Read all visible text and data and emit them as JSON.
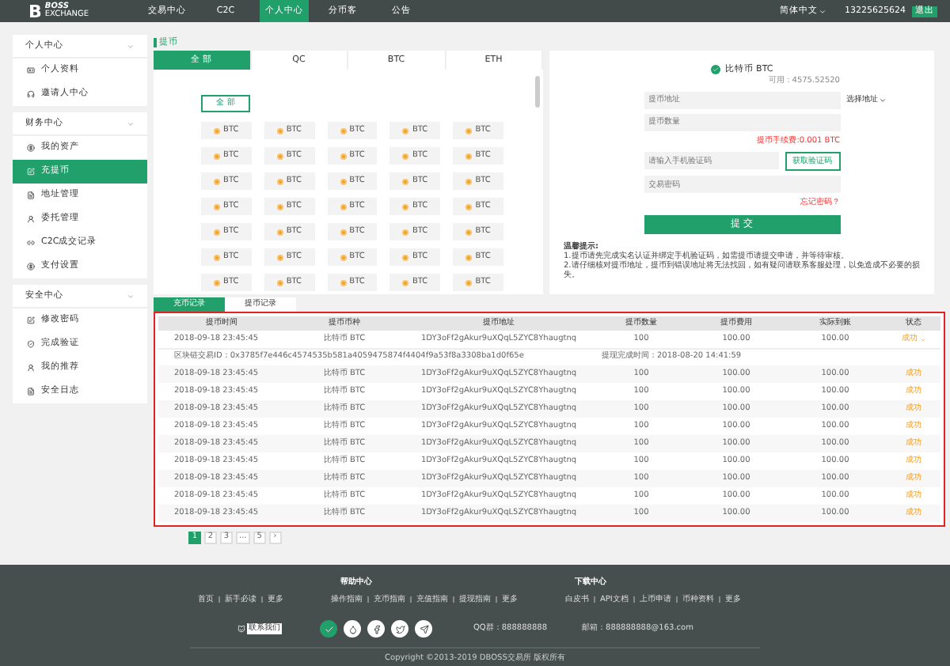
{
  "nav": {
    "logo_letter": "B",
    "logo_text": "BOSS",
    "logo_sub": "EXCHANGE",
    "items": [
      {
        "label": "交易中心",
        "selected": false
      },
      {
        "label": "C2C",
        "selected": false
      },
      {
        "label": "个人中心",
        "selected": true
      },
      {
        "label": "分币客",
        "selected": false
      },
      {
        "label": "公告",
        "selected": false
      }
    ],
    "language": "简体中文",
    "phone": "13225625624",
    "logout": "退出"
  },
  "sidebar": {
    "sections": [
      {
        "title": "个人中心",
        "expanded": true,
        "items": [
          {
            "label": "个人资料",
            "selected": false
          },
          {
            "label": "邀请人中心",
            "selected": false
          }
        ]
      },
      {
        "title": "财务中心",
        "expanded": true,
        "items": [
          {
            "label": "我的资产",
            "selected": false
          },
          {
            "label": "充提币",
            "selected": true
          },
          {
            "label": "地址管理",
            "selected": false
          },
          {
            "label": "委托管理",
            "selected": false
          },
          {
            "label": "C2C成交记录",
            "selected": false
          },
          {
            "label": "支付设置",
            "selected": false
          }
        ]
      },
      {
        "title": "安全中心",
        "expanded": true,
        "items": [
          {
            "label": "修改密码",
            "selected": false
          },
          {
            "label": "完成验证",
            "selected": false
          },
          {
            "label": "我的推荐",
            "selected": false
          },
          {
            "label": "安全日志",
            "selected": false
          }
        ]
      }
    ]
  },
  "withdraw": {
    "section_title": "提币",
    "coin_tabs": [
      {
        "label": "全 部",
        "selected": true
      },
      {
        "label": "QC",
        "selected": false
      },
      {
        "label": "BTC",
        "selected": false
      },
      {
        "label": "ETH",
        "selected": false
      }
    ],
    "all_button": "全 部",
    "coins": [
      {
        "symbol": "BTC"
      },
      {
        "symbol": "BTC"
      },
      {
        "symbol": "BTC"
      },
      {
        "symbol": "BTC"
      },
      {
        "symbol": "BTC"
      },
      {
        "symbol": "BTC"
      },
      {
        "symbol": "BTC"
      },
      {
        "symbol": "BTC"
      },
      {
        "symbol": "BTC"
      },
      {
        "symbol": "BTC"
      },
      {
        "symbol": "BTC"
      },
      {
        "symbol": "BTC"
      },
      {
        "symbol": "BTC"
      },
      {
        "symbol": "BTC"
      },
      {
        "symbol": "BTC"
      },
      {
        "symbol": "BTC"
      },
      {
        "symbol": "BTC"
      },
      {
        "symbol": "BTC"
      },
      {
        "symbol": "BTC"
      },
      {
        "symbol": "BTC"
      },
      {
        "symbol": "BTC"
      },
      {
        "symbol": "BTC"
      },
      {
        "symbol": "BTC"
      },
      {
        "symbol": "BTC"
      },
      {
        "symbol": "BTC"
      },
      {
        "symbol": "BTC"
      },
      {
        "symbol": "BTC"
      },
      {
        "symbol": "BTC"
      },
      {
        "symbol": "BTC"
      },
      {
        "symbol": "BTC"
      },
      {
        "symbol": "BTC"
      },
      {
        "symbol": "BTC"
      },
      {
        "symbol": "BTC"
      },
      {
        "symbol": "BTC"
      },
      {
        "symbol": "BTC"
      }
    ]
  },
  "form": {
    "coin_name": "比特币 BTC",
    "available": "可用：4575.52520",
    "address_placeholder": "提币地址",
    "select_address": "选择地址",
    "amount_placeholder": "提币数量",
    "fee_note": "提币手续费:0.001 BTC",
    "code_placeholder": "请输入手机验证码",
    "get_code": "获取验证码",
    "password_placeholder": "交易密码",
    "forgot": "忘记密码？",
    "submit": "提 交",
    "tips_title": "温馨提示:",
    "tips": [
      "1.提币请先完成实名认证并绑定手机验证码，如需提币请提交申请，并等待审核。",
      "2.请仔细核对提币地址，提币到错误地址将无法找回，如有疑问请联系客服处理，以免造成不必要的损失。"
    ]
  },
  "records": {
    "tabs": [
      {
        "label": "充币记录",
        "selected": true
      },
      {
        "label": "提币记录",
        "selected": false
      }
    ],
    "columns": [
      "提币时间",
      "提币币种",
      "提币地址",
      "提币数量",
      "提币费用",
      "实际到账",
      "状态"
    ],
    "rows": [
      {
        "cells": [
          "2018-09-18 23:45:45",
          "比特币 BTC",
          "1DY3oFf2gAkur9uXQqL5ZYC8Yhaugtnq",
          "100",
          "100.00",
          "100.00"
        ],
        "status": "成功",
        "expanded": true,
        "txid": "区块链交易ID：0x3785f7e446c4574535b581a4059475874f4404f9a53f8a3308ba1d0f65e",
        "finish_time": "提现完成时间：2018-08-20 14:41:59"
      },
      {
        "cells": [
          "2018-09-18 23:45:45",
          "比特币 BTC",
          "1DY3oFf2gAkur9uXQqL5ZYC8Yhaugtnq",
          "100",
          "100.00",
          "100.00"
        ],
        "status": "成功",
        "expanded": false
      },
      {
        "cells": [
          "2018-09-18 23:45:45",
          "比特币 BTC",
          "1DY3oFf2gAkur9uXQqL5ZYC8Yhaugtnq",
          "100",
          "100.00",
          "100.00"
        ],
        "status": "成功",
        "expanded": false
      },
      {
        "cells": [
          "2018-09-18 23:45:45",
          "比特币 BTC",
          "1DY3oFf2gAkur9uXQqL5ZYC8Yhaugtnq",
          "100",
          "100.00",
          "100.00"
        ],
        "status": "成功",
        "expanded": false
      },
      {
        "cells": [
          "2018-09-18 23:45:45",
          "比特币 BTC",
          "1DY3oFf2gAkur9uXQqL5ZYC8Yhaugtnq",
          "100",
          "100.00",
          "100.00"
        ],
        "status": "成功",
        "expanded": false
      },
      {
        "cells": [
          "2018-09-18 23:45:45",
          "比特币 BTC",
          "1DY3oFf2gAkur9uXQqL5ZYC8Yhaugtnq",
          "100",
          "100.00",
          "100.00"
        ],
        "status": "成功",
        "expanded": false
      },
      {
        "cells": [
          "2018-09-18 23:45:45",
          "比特币 BTC",
          "1DY3oFf2gAkur9uXQqL5ZYC8Yhaugtnq",
          "100",
          "100.00",
          "100.00"
        ],
        "status": "成功",
        "expanded": false
      },
      {
        "cells": [
          "2018-09-18 23:45:45",
          "比特币 BTC",
          "1DY3oFf2gAkur9uXQqL5ZYC8Yhaugtnq",
          "100",
          "100.00",
          "100.00"
        ],
        "status": "成功",
        "expanded": false
      },
      {
        "cells": [
          "2018-09-18 23:45:45",
          "比特币 BTC",
          "1DY3oFf2gAkur9uXQqL5ZYC8Yhaugtnq",
          "100",
          "100.00",
          "100.00"
        ],
        "status": "成功",
        "expanded": false
      },
      {
        "cells": [
          "2018-09-18 23:45:45",
          "比特币 BTC",
          "1DY3oFf2gAkur9uXQqL5ZYC8Yhaugtnq",
          "100",
          "100.00",
          "100.00"
        ],
        "status": "成功",
        "expanded": false
      }
    ],
    "pages": [
      {
        "label": "1",
        "selected": true
      },
      {
        "label": "2",
        "selected": false
      },
      {
        "label": "3",
        "selected": false
      },
      {
        "label": "...",
        "selected": false
      },
      {
        "label": "5",
        "selected": false
      },
      {
        "label": "›",
        "selected": false
      }
    ]
  },
  "footer": {
    "links": [
      "首页",
      "新手必读",
      "更多"
    ],
    "groups": [
      {
        "title": "帮助中心",
        "links": [
          "操作指南",
          "充币指南",
          "充值指南",
          "提现指南",
          "更多"
        ]
      },
      {
        "title": "下载中心",
        "links": [
          "白皮书",
          "API文档",
          "上币申请",
          "币种资料",
          "更多"
        ]
      }
    ],
    "contact": "联系我们",
    "qq": "QQ群：888888888",
    "email": "邮箱：888888888@163.com",
    "copyright": "Copyright ©2013-2019 DBOSS交易所 版权所有"
  }
}
